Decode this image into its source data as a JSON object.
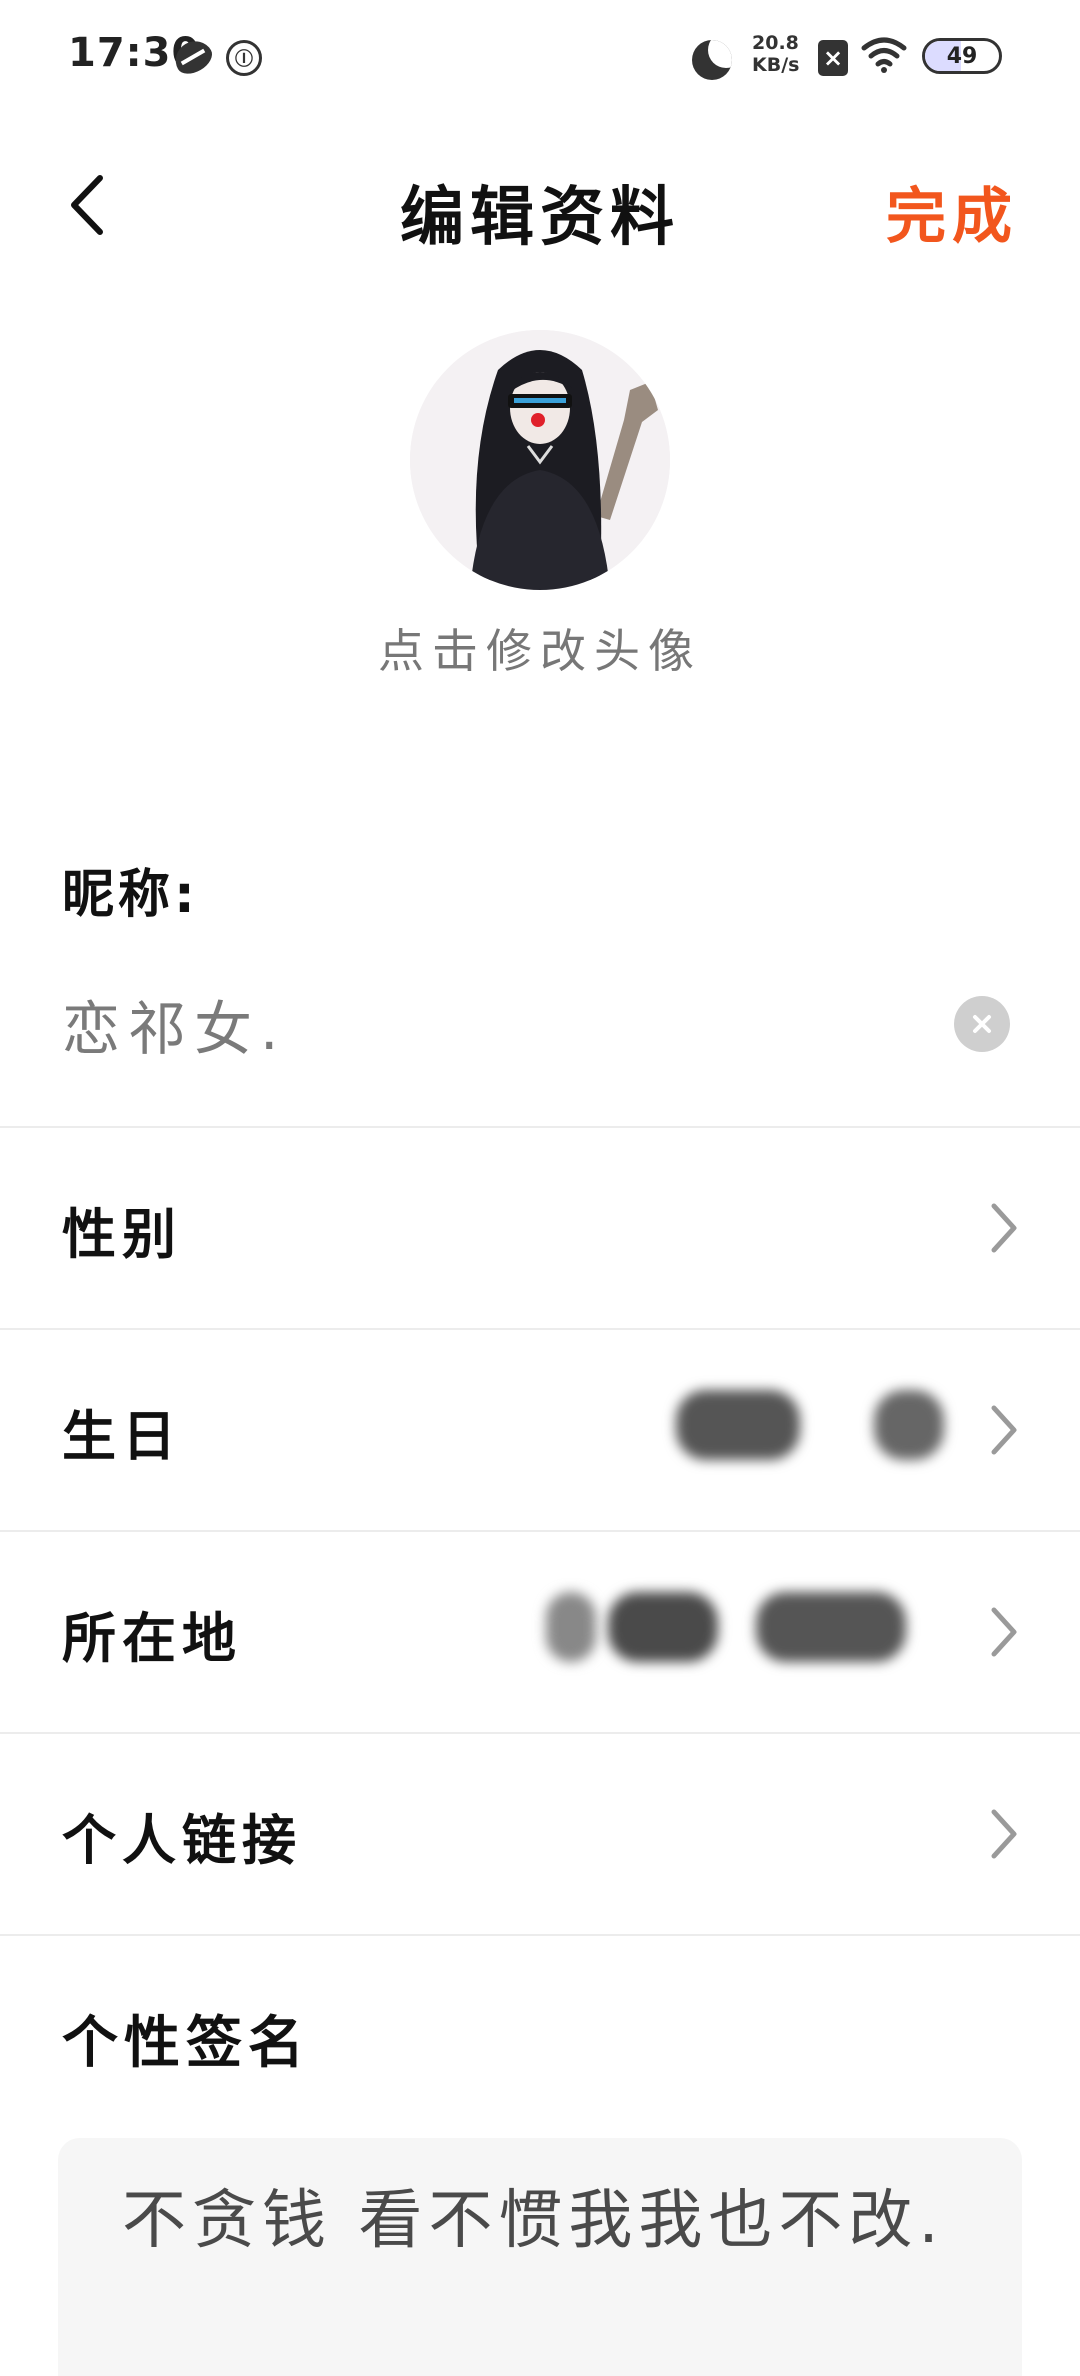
{
  "status_bar": {
    "time": "17:30",
    "net_speed_value": "20.8",
    "net_speed_unit": "KB/s",
    "battery_level": "49",
    "battery_fraction": 0.49,
    "icons": [
      "leaf-icon",
      "circle-icon",
      "moon-icon",
      "no-sim-icon",
      "wifi-icon",
      "battery-icon"
    ]
  },
  "header": {
    "title": "编辑资料",
    "done_label": "完成",
    "back_icon": "chevron-left-icon"
  },
  "avatar": {
    "hint": "点击修改头像"
  },
  "nickname": {
    "label": "昵称:",
    "value": "恋祁女."
  },
  "rows": [
    {
      "label": "性别"
    },
    {
      "label": "生日"
    },
    {
      "label": "所在地"
    },
    {
      "label": "个人链接"
    }
  ],
  "signature": {
    "label": "个性签名",
    "text": "不贪钱 看不惯我我也不改."
  },
  "colors": {
    "accent": "#f2561d",
    "divider": "#ececec",
    "placeholder_gray": "#7a7a7a"
  }
}
